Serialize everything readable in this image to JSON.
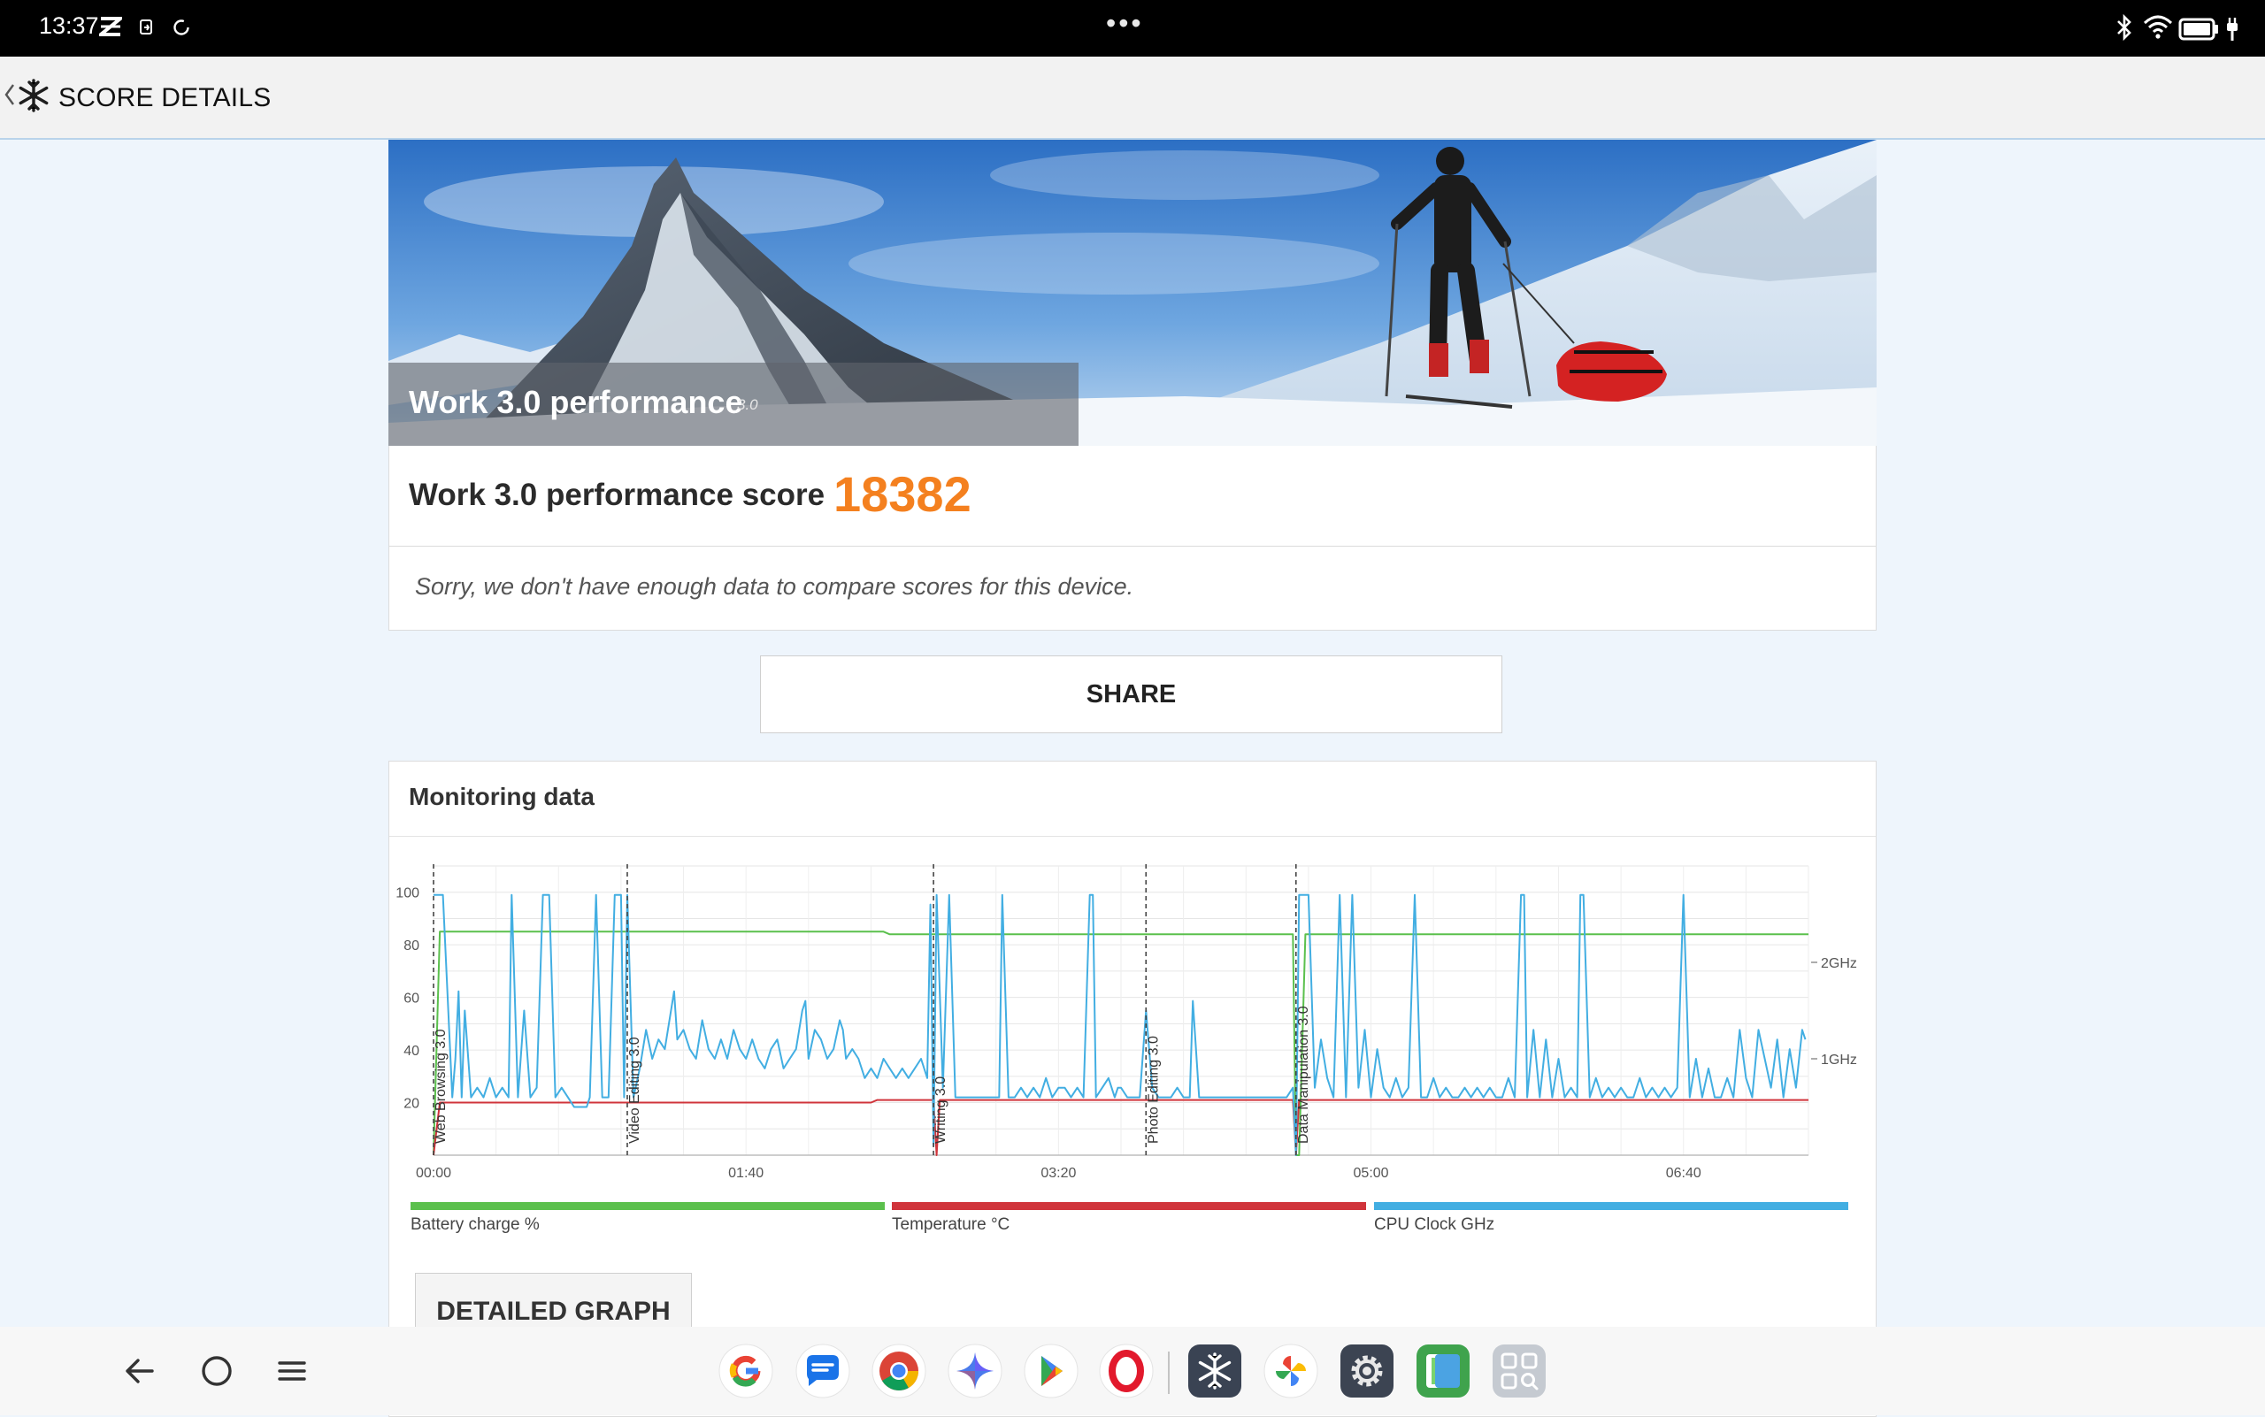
{
  "status_bar": {
    "time": "13:37"
  },
  "header": {
    "title": "SCORE DETAILS"
  },
  "hero": {
    "title": "Work 3.0 performance",
    "version": "3.0"
  },
  "score": {
    "label": "Work 3.0 performance score",
    "value": "18382"
  },
  "compare": {
    "message": "Sorry, we don't have enough data to compare scores for this device."
  },
  "share": {
    "label": "SHARE"
  },
  "monitoring": {
    "title": "Monitoring data",
    "detailed_label": "DETAILED GRAPH",
    "legend": [
      {
        "label": "Battery charge %",
        "color": "#5bc04d"
      },
      {
        "label": "Temperature °C",
        "color": "#d0343b"
      },
      {
        "label": "CPU Clock GHz",
        "color": "#42aee2"
      }
    ]
  },
  "chart_data": {
    "type": "line",
    "x_unit": "seconds",
    "x_range": [
      0,
      440
    ],
    "y_left_range": [
      0,
      110
    ],
    "y_left_ticks": [
      100,
      80,
      60,
      40,
      20
    ],
    "y_right_ticks": [
      {
        "value": 2,
        "label": "2GHz"
      },
      {
        "value": 1,
        "label": "1GHz"
      }
    ],
    "y_right_range": [
      0,
      3
    ],
    "x_ticks": [
      {
        "t": 0,
        "label": "00:00"
      },
      {
        "t": 100,
        "label": "01:40"
      },
      {
        "t": 200,
        "label": "03:20"
      },
      {
        "t": 300,
        "label": "05:00"
      },
      {
        "t": 400,
        "label": "06:40"
      }
    ],
    "markers": [
      {
        "t": 0,
        "label": "Web Browsing 3.0"
      },
      {
        "t": 62,
        "label": "Video Editing 3.0"
      },
      {
        "t": 160,
        "label": "Writing 3.0"
      },
      {
        "t": 228,
        "label": "Photo Editing 3.0"
      },
      {
        "t": 276,
        "label": "Data Manipulation 3.0"
      }
    ],
    "series": [
      {
        "name": "Battery charge %",
        "axis": "left",
        "points": [
          [
            0,
            0
          ],
          [
            2,
            85
          ],
          [
            144,
            85
          ],
          [
            146,
            84
          ],
          [
            275,
            84
          ],
          [
            276,
            0
          ],
          [
            277,
            0
          ],
          [
            279,
            84
          ],
          [
            440,
            84
          ]
        ]
      },
      {
        "name": "Temperature °C",
        "axis": "left",
        "points": [
          [
            0,
            0
          ],
          [
            2,
            20
          ],
          [
            140,
            20
          ],
          [
            142,
            21
          ],
          [
            160,
            21
          ],
          [
            161,
            0
          ],
          [
            162,
            21
          ],
          [
            275,
            21
          ],
          [
            276,
            0
          ],
          [
            277,
            21
          ],
          [
            440,
            21
          ]
        ]
      },
      {
        "name": "CPU Clock GHz",
        "axis": "right",
        "points": [
          [
            0,
            2.7
          ],
          [
            3,
            2.7
          ],
          [
            6,
            0.6
          ],
          [
            7,
            1.0
          ],
          [
            8,
            1.7
          ],
          [
            9,
            0.6
          ],
          [
            10,
            1.5
          ],
          [
            12,
            0.6
          ],
          [
            14,
            0.7
          ],
          [
            16,
            0.6
          ],
          [
            18,
            0.8
          ],
          [
            20,
            0.6
          ],
          [
            22,
            0.7
          ],
          [
            24,
            0.6
          ],
          [
            25,
            2.7
          ],
          [
            27,
            0.6
          ],
          [
            29,
            1.5
          ],
          [
            31,
            0.6
          ],
          [
            33,
            0.7
          ],
          [
            35,
            2.7
          ],
          [
            37,
            2.7
          ],
          [
            39,
            0.6
          ],
          [
            41,
            0.7
          ],
          [
            43,
            0.6
          ],
          [
            45,
            0.5
          ],
          [
            47,
            0.5
          ],
          [
            49,
            0.5
          ],
          [
            50,
            0.6
          ],
          [
            52,
            2.7
          ],
          [
            54,
            0.6
          ],
          [
            56,
            0.6
          ],
          [
            58,
            2.7
          ],
          [
            60,
            2.7
          ],
          [
            61,
            0.6
          ],
          [
            62,
            2.7
          ],
          [
            64,
            0.6
          ],
          [
            66,
            0.9
          ],
          [
            68,
            1.3
          ],
          [
            70,
            1.0
          ],
          [
            72,
            1.2
          ],
          [
            74,
            1.1
          ],
          [
            76,
            1.5
          ],
          [
            77,
            1.7
          ],
          [
            78,
            1.2
          ],
          [
            80,
            1.3
          ],
          [
            82,
            1.1
          ],
          [
            84,
            1.0
          ],
          [
            86,
            1.4
          ],
          [
            88,
            1.1
          ],
          [
            90,
            1.0
          ],
          [
            92,
            1.2
          ],
          [
            94,
            1.0
          ],
          [
            96,
            1.3
          ],
          [
            98,
            1.1
          ],
          [
            100,
            1.0
          ],
          [
            102,
            1.2
          ],
          [
            104,
            1.0
          ],
          [
            106,
            0.9
          ],
          [
            108,
            1.1
          ],
          [
            110,
            1.2
          ],
          [
            112,
            0.9
          ],
          [
            114,
            1.0
          ],
          [
            116,
            1.1
          ],
          [
            118,
            1.5
          ],
          [
            119,
            1.6
          ],
          [
            120,
            1.0
          ],
          [
            122,
            1.3
          ],
          [
            124,
            1.2
          ],
          [
            126,
            1.0
          ],
          [
            128,
            1.1
          ],
          [
            130,
            1.4
          ],
          [
            131,
            1.3
          ],
          [
            132,
            1.0
          ],
          [
            134,
            1.1
          ],
          [
            136,
            1.0
          ],
          [
            138,
            0.8
          ],
          [
            140,
            0.9
          ],
          [
            142,
            0.8
          ],
          [
            144,
            1.0
          ],
          [
            146,
            0.9
          ],
          [
            148,
            0.8
          ],
          [
            150,
            0.9
          ],
          [
            152,
            0.8
          ],
          [
            154,
            0.9
          ],
          [
            156,
            1.0
          ],
          [
            158,
            0.8
          ],
          [
            159,
            2.6
          ],
          [
            160,
            0.1
          ],
          [
            161,
            2.7
          ],
          [
            163,
            0.7
          ],
          [
            165,
            2.7
          ],
          [
            167,
            0.6
          ],
          [
            169,
            0.6
          ],
          [
            171,
            0.6
          ],
          [
            173,
            0.6
          ],
          [
            175,
            0.6
          ],
          [
            177,
            0.6
          ],
          [
            179,
            0.6
          ],
          [
            181,
            0.6
          ],
          [
            182,
            2.7
          ],
          [
            184,
            0.6
          ],
          [
            186,
            0.6
          ],
          [
            188,
            0.7
          ],
          [
            190,
            0.6
          ],
          [
            192,
            0.7
          ],
          [
            194,
            0.6
          ],
          [
            196,
            0.8
          ],
          [
            198,
            0.6
          ],
          [
            200,
            0.7
          ],
          [
            202,
            0.7
          ],
          [
            204,
            0.6
          ],
          [
            206,
            0.7
          ],
          [
            208,
            0.6
          ],
          [
            210,
            2.7
          ],
          [
            211,
            2.7
          ],
          [
            212,
            0.6
          ],
          [
            214,
            0.7
          ],
          [
            216,
            0.8
          ],
          [
            218,
            0.6
          ],
          [
            219,
            0.7
          ],
          [
            220,
            0.7
          ],
          [
            222,
            0.6
          ],
          [
            224,
            0.6
          ],
          [
            226,
            0.6
          ],
          [
            228,
            1.5
          ],
          [
            230,
            0.7
          ],
          [
            232,
            0.6
          ],
          [
            234,
            0.6
          ],
          [
            236,
            0.6
          ],
          [
            238,
            0.7
          ],
          [
            240,
            0.6
          ],
          [
            242,
            0.6
          ],
          [
            243,
            1.6
          ],
          [
            245,
            0.6
          ],
          [
            247,
            0.6
          ],
          [
            249,
            0.6
          ],
          [
            251,
            0.6
          ],
          [
            253,
            0.6
          ],
          [
            255,
            0.6
          ],
          [
            257,
            0.6
          ],
          [
            259,
            0.6
          ],
          [
            261,
            0.6
          ],
          [
            263,
            0.6
          ],
          [
            265,
            0.6
          ],
          [
            267,
            0.6
          ],
          [
            269,
            0.6
          ],
          [
            271,
            0.6
          ],
          [
            273,
            0.6
          ],
          [
            275,
            0.7
          ],
          [
            276,
            0.0
          ],
          [
            277,
            2.7
          ],
          [
            280,
            2.7
          ],
          [
            282,
            0.7
          ],
          [
            284,
            1.2
          ],
          [
            286,
            0.8
          ],
          [
            288,
            0.6
          ],
          [
            290,
            2.7
          ],
          [
            292,
            0.6
          ],
          [
            294,
            2.7
          ],
          [
            296,
            0.7
          ],
          [
            298,
            1.3
          ],
          [
            300,
            0.6
          ],
          [
            302,
            1.1
          ],
          [
            304,
            0.7
          ],
          [
            306,
            0.6
          ],
          [
            308,
            0.8
          ],
          [
            310,
            0.6
          ],
          [
            312,
            0.7
          ],
          [
            314,
            2.7
          ],
          [
            316,
            0.6
          ],
          [
            318,
            0.6
          ],
          [
            320,
            0.8
          ],
          [
            322,
            0.6
          ],
          [
            324,
            0.7
          ],
          [
            326,
            0.6
          ],
          [
            328,
            0.6
          ],
          [
            330,
            0.7
          ],
          [
            332,
            0.6
          ],
          [
            334,
            0.7
          ],
          [
            336,
            0.6
          ],
          [
            338,
            0.7
          ],
          [
            340,
            0.6
          ],
          [
            342,
            0.6
          ],
          [
            344,
            0.8
          ],
          [
            346,
            0.6
          ],
          [
            348,
            2.7
          ],
          [
            349,
            2.7
          ],
          [
            350,
            0.6
          ],
          [
            352,
            1.3
          ],
          [
            354,
            0.6
          ],
          [
            356,
            1.2
          ],
          [
            358,
            0.6
          ],
          [
            360,
            1.0
          ],
          [
            362,
            0.6
          ],
          [
            364,
            0.7
          ],
          [
            366,
            0.6
          ],
          [
            367,
            2.7
          ],
          [
            368,
            2.7
          ],
          [
            370,
            0.6
          ],
          [
            372,
            0.8
          ],
          [
            374,
            0.6
          ],
          [
            376,
            0.7
          ],
          [
            378,
            0.6
          ],
          [
            380,
            0.7
          ],
          [
            382,
            0.6
          ],
          [
            384,
            0.6
          ],
          [
            386,
            0.8
          ],
          [
            388,
            0.6
          ],
          [
            390,
            0.7
          ],
          [
            392,
            0.6
          ],
          [
            394,
            0.7
          ],
          [
            396,
            0.6
          ],
          [
            398,
            0.7
          ],
          [
            400,
            2.7
          ],
          [
            402,
            0.6
          ],
          [
            404,
            1.0
          ],
          [
            406,
            0.6
          ],
          [
            408,
            0.9
          ],
          [
            410,
            0.6
          ],
          [
            412,
            0.6
          ],
          [
            414,
            0.8
          ],
          [
            416,
            0.6
          ],
          [
            418,
            1.3
          ],
          [
            420,
            0.8
          ],
          [
            422,
            0.6
          ],
          [
            424,
            1.3
          ],
          [
            426,
            1.0
          ],
          [
            428,
            0.7
          ],
          [
            430,
            1.2
          ],
          [
            432,
            0.6
          ],
          [
            434,
            1.1
          ],
          [
            436,
            0.7
          ],
          [
            438,
            1.3
          ],
          [
            439,
            1.2
          ]
        ]
      }
    ]
  }
}
